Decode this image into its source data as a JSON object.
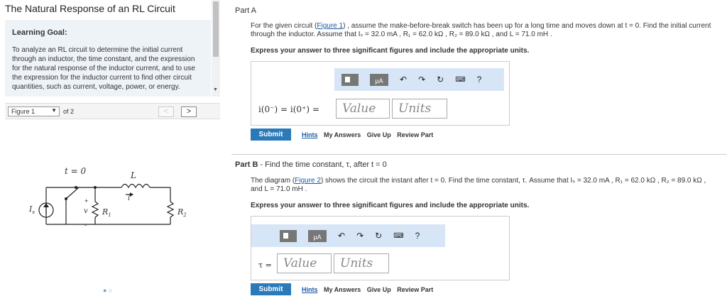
{
  "left": {
    "title": "The Natural Response of an RL Circuit",
    "goal_heading": "Learning Goal:",
    "goal_text": "To analyze an RL circuit to determine the initial current through an inductor, the time constant, and the expression for the natural response of the inductor current, and to use the expression for the inductor current to find other circuit quantities, such as current, voltage, power, or energy.",
    "figure_select": "Figure 1",
    "figure_of": "of 2",
    "prev": "<",
    "next": ">",
    "circuit_labels": {
      "t0": "t = 0",
      "L": "L",
      "i": "i",
      "Is": "I",
      "Is_sub": "s",
      "v": "v",
      "plus": "+",
      "minus": "-",
      "R1": "R",
      "R1_sub": "1",
      "R2": "R",
      "R2_sub": "2"
    },
    "pager_dots": "● ○"
  },
  "partA": {
    "title": "Part A",
    "text_pre": "For the given circuit (",
    "link": "Figure 1",
    "text_post": ") , assume the make-before-break switch has been up for a long time and moves down at t = 0. Find the initial current through the inductor. Assume that Iₛ = 32.0 mA , R₁ = 62.0 kΩ , R₂ = 89.0 kΩ , and L = 71.0 mH .",
    "instruction": "Express your answer to three significant figures and include the appropriate units.",
    "eq_label": "i(0⁻) = i(0⁺) =",
    "value_placeholder": "Value",
    "units_placeholder": "Units",
    "submit": "Submit",
    "hints": "Hints",
    "my_answers": "My Answers",
    "give_up": "Give Up",
    "review": "Review Part"
  },
  "partB": {
    "title": "Part B",
    "subtitle": " - Find the time constant, τ, after t = 0",
    "text_pre": "The diagram (",
    "link": "Figure 2",
    "text_post": ") shows the circuit the instant after t = 0. Find the time constant, τ. Assume that Iₛ = 32.0 mA , R₁ = 62.0 kΩ , R₂ = 89.0 kΩ , and L = 71.0 mH .",
    "instruction": "Express your answer to three significant figures and include the appropriate units.",
    "eq_label": "τ =",
    "value_placeholder": "Value",
    "units_placeholder": "Units",
    "submit": "Submit",
    "hints": "Hints",
    "my_answers": "My Answers",
    "give_up": "Give Up",
    "review": "Review Part"
  },
  "toolbar": {
    "mu_label": "μA",
    "undo_icon": "undo-icon",
    "redo_icon": "redo-icon",
    "reset_icon": "reset-icon",
    "keyboard_icon": "keyboard-icon",
    "help": "?"
  }
}
